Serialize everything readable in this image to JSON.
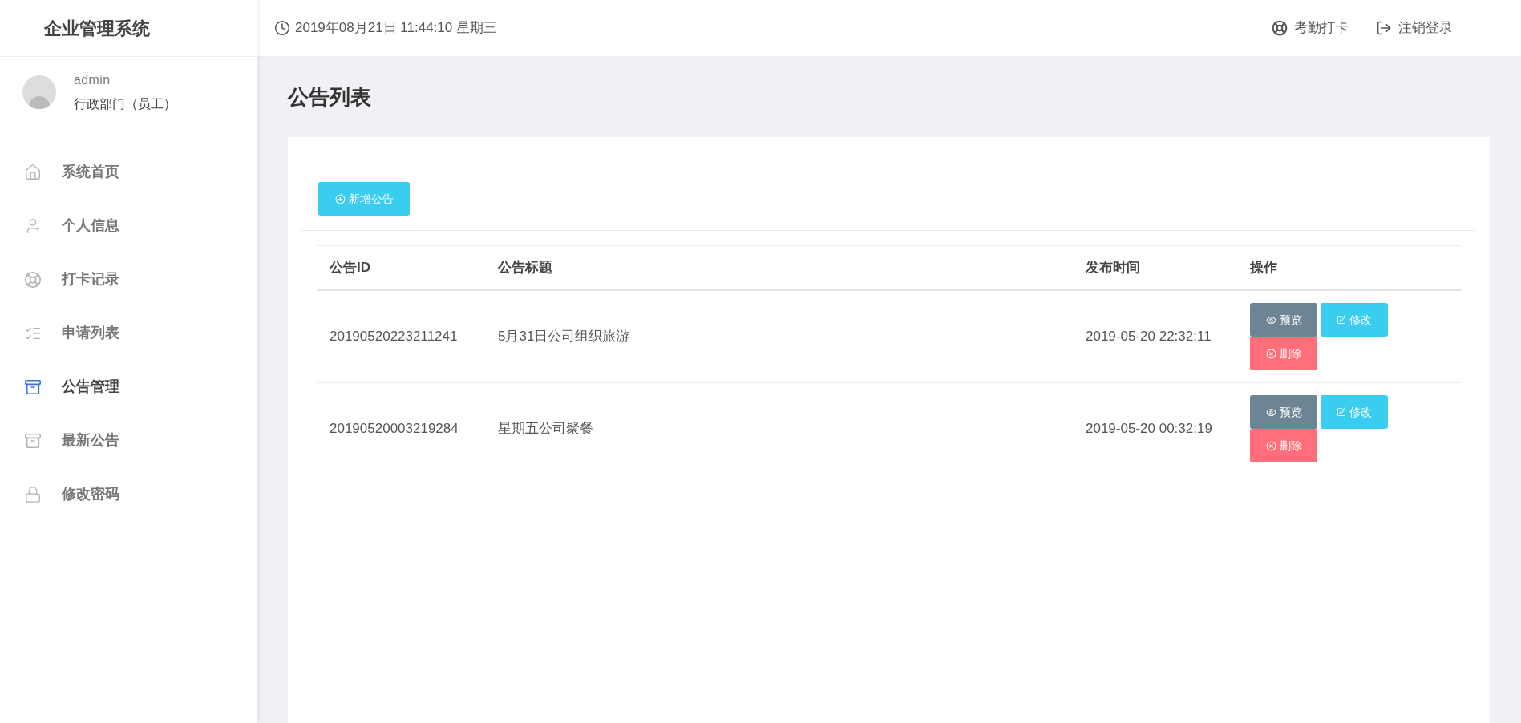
{
  "app_title": "企业管理系统",
  "header": {
    "datetime": "2019年08月21日 11:44:10 星期三",
    "actions": [
      {
        "kind": "clock-in",
        "label": "考勤打卡"
      },
      {
        "kind": "logout",
        "label": "注销登录"
      }
    ]
  },
  "user": {
    "name": "admin",
    "department": "行政部门（员工）"
  },
  "sidebar": {
    "items": [
      {
        "kind": "home",
        "label": "系统首页",
        "selected": false
      },
      {
        "kind": "user",
        "label": "个人信息",
        "selected": false
      },
      {
        "kind": "badge",
        "label": "打卡记录",
        "selected": false
      },
      {
        "kind": "list",
        "label": "申请列表",
        "selected": false
      },
      {
        "kind": "box",
        "label": "公告管理",
        "selected": true
      },
      {
        "kind": "box",
        "label": "最新公告",
        "selected": false
      },
      {
        "kind": "lock",
        "label": "修改密码",
        "selected": false
      }
    ]
  },
  "page_title": "公告列表",
  "add_button": "新增公告",
  "table": {
    "columns": [
      "公告ID",
      "公告标题",
      "发布时间",
      "操作"
    ],
    "rows": [
      {
        "id": "20190520223211241",
        "title": "5月31日公司组织旅游",
        "time": "2019-05-20 22:32:11",
        "actions": [
          {
            "kind": "preview",
            "label": "预览"
          },
          {
            "kind": "edit",
            "label": "修改"
          },
          {
            "kind": "delete",
            "label": "删除"
          }
        ]
      },
      {
        "id": "20190520003219284",
        "title": "星期五公司聚餐",
        "time": "2019-05-20 00:32:19",
        "actions": [
          {
            "kind": "preview",
            "label": "预览"
          },
          {
            "kind": "edit",
            "label": "修改"
          },
          {
            "kind": "delete",
            "label": "删除"
          }
        ]
      }
    ]
  }
}
